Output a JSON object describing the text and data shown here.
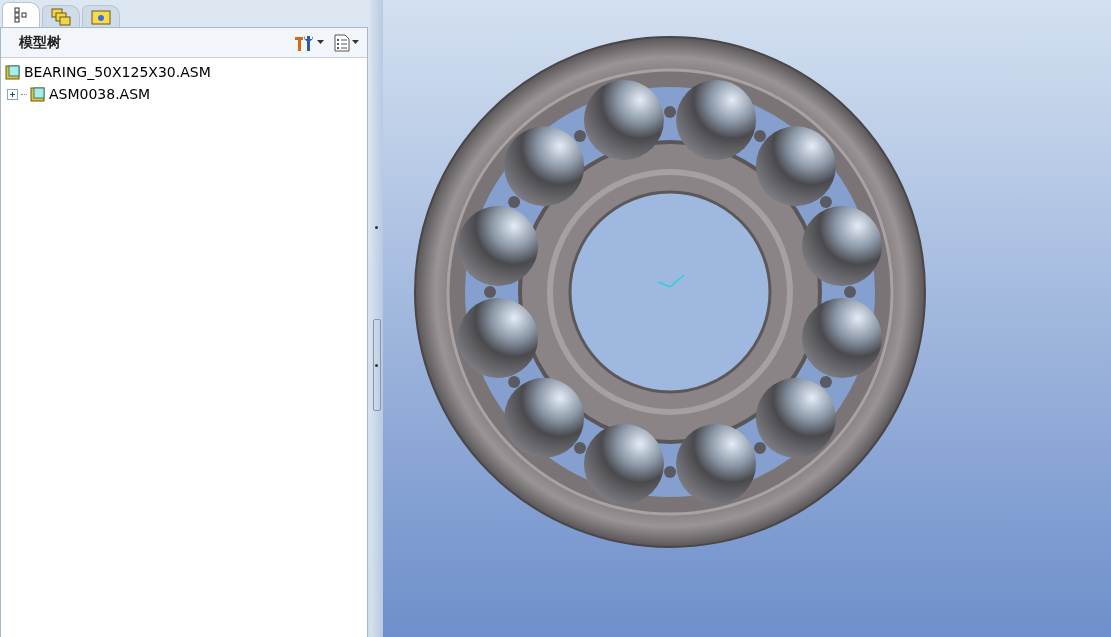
{
  "tabs": [
    {
      "kind": "model-tree",
      "selected": true
    },
    {
      "kind": "layers",
      "selected": false
    },
    {
      "kind": "favorites",
      "selected": false
    }
  ],
  "panel": {
    "title": "模型树"
  },
  "tree": [
    {
      "label": "BEARING_50X125X30.ASM",
      "children": [
        {
          "label": "ASM0038.ASM",
          "expanded": false
        }
      ]
    }
  ]
}
